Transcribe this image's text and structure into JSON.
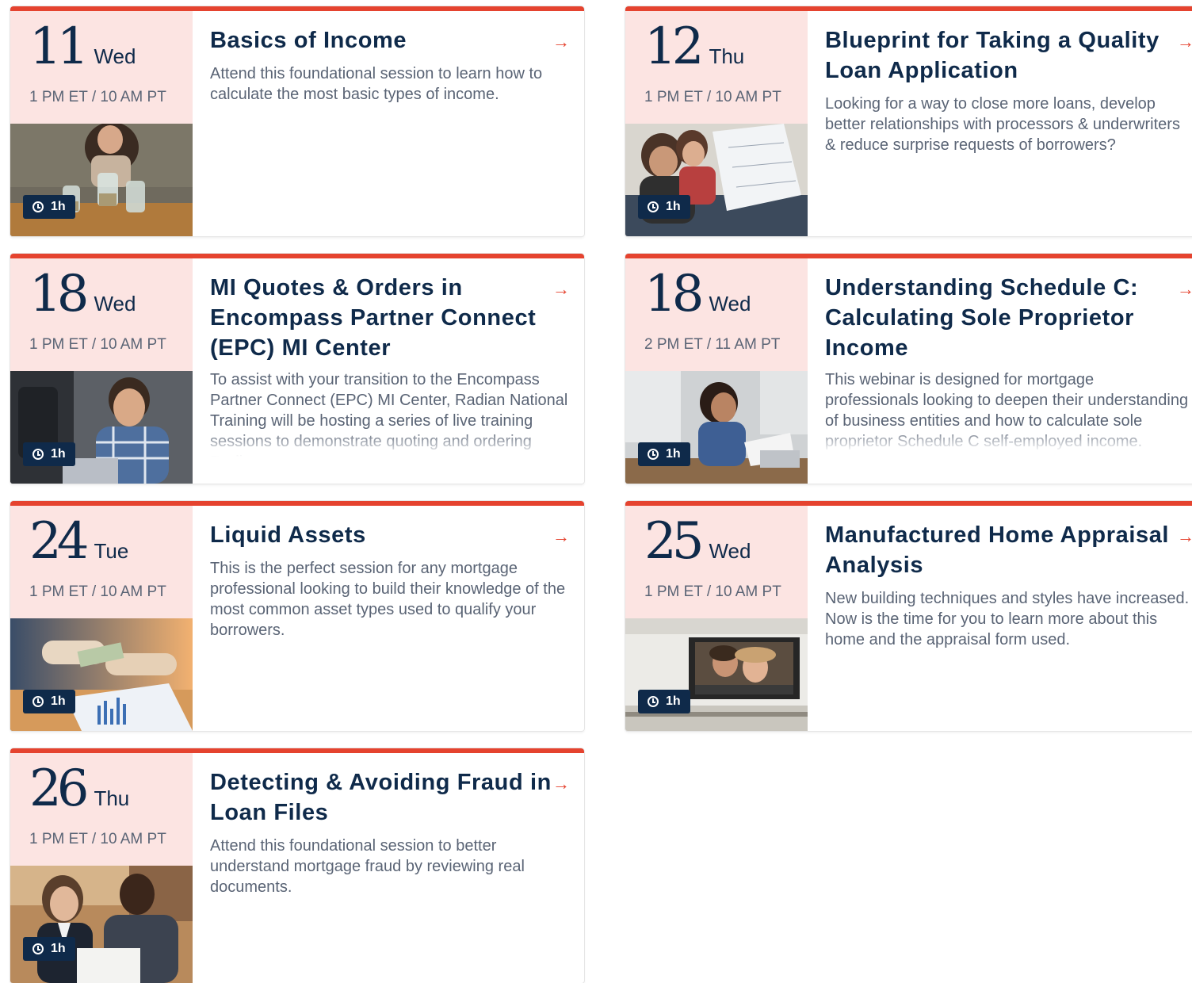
{
  "accent_color": "#e5432f",
  "navy_color": "#0f2a4a",
  "date_panel_color": "#fce4e2",
  "arrow_icon": "arrow-right-icon",
  "clock_icon": "clock-icon",
  "sessions": [
    {
      "day": "11",
      "weekday": "Wed",
      "time": "1 PM ET / 10 AM PT",
      "duration": "1h",
      "title": "Basics of Income",
      "description": "Attend this foundational session to learn how to calculate the most basic types of income.",
      "image": "woman putting coins into jars"
    },
    {
      "day": "12",
      "weekday": "Thu",
      "time": "1 PM ET / 10 AM PT",
      "duration": "1h",
      "title": "Blueprint for Taking a Quality Loan Application",
      "description": "Looking for a way to close more loans, develop better relationships with processors & underwriters & reduce surprise requests of borrowers?",
      "image": "couple reviewing blueprints"
    },
    {
      "day": "18",
      "weekday": "Wed",
      "time": "1 PM ET / 10 AM PT",
      "duration": "1h",
      "title": "MI Quotes & Orders in Encompass Partner Connect (EPC) MI Center",
      "description": "To assist with your transition to the Encompass Partner Connect (EPC) MI Center, Radian National Training will be hosting a series of live training sessions to demonstrate quoting and ordering Radian",
      "image": "smiling man at laptop"
    },
    {
      "day": "18",
      "weekday": "Wed",
      "time": "2 PM ET / 11 AM PT",
      "duration": "1h",
      "title": "Understanding Schedule C: Calculating Sole Proprietor Income",
      "description": "This webinar is designed for mortgage professionals looking to deepen their understanding of business entities and how to calculate sole proprietor Schedule C self-employed income.",
      "image": "woman working with papers and laptop"
    },
    {
      "day": "24",
      "weekday": "Tue",
      "time": "1 PM ET / 10 AM PT",
      "duration": "1h",
      "title": "Liquid Assets",
      "description": "This is the perfect session for any mortgage professional looking to build their knowledge of the most common asset types used to qualify your borrowers.",
      "image": "hands exchanging cash over charts"
    },
    {
      "day": "25",
      "weekday": "Wed",
      "time": "1 PM ET / 10 AM PT",
      "duration": "1h",
      "title": "Manufactured Home Appraisal Analysis",
      "description": "New building techniques and styles have increased. Now is the time for you to learn more about this home and the appraisal form used.",
      "image": "couple looking out of trailer window"
    },
    {
      "day": "26",
      "weekday": "Thu",
      "time": "1 PM ET / 10 AM PT",
      "duration": "1h",
      "title": "Detecting & Avoiding Fraud in Loan Files",
      "description": "Attend this foundational session to better understand mortgage fraud by reviewing real documents.",
      "image": "two business people reviewing documents"
    }
  ]
}
